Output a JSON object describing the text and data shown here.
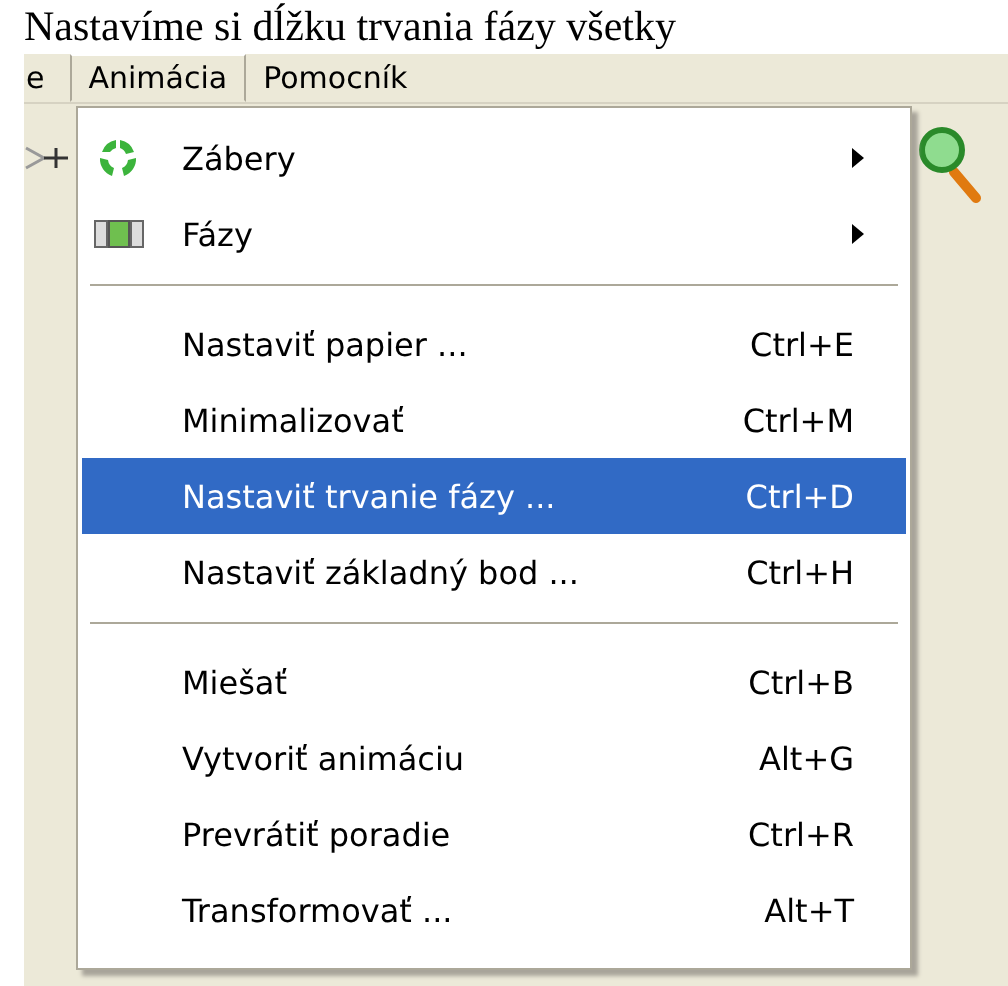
{
  "heading": "Nastavíme si dĺžku trvania fázy všetky",
  "menubar": [
    {
      "label": "e",
      "selected": false
    },
    {
      "label": "Animácia",
      "selected": true
    },
    {
      "label": "Pomocník",
      "selected": false
    }
  ],
  "menu": {
    "sections": [
      [
        {
          "kind": "submenu",
          "label": "Zábery",
          "selected": false
        },
        {
          "kind": "submenu",
          "label": "Fázy",
          "selected": false
        }
      ],
      [
        {
          "kind": "command",
          "label": "Nastaviť papier ...",
          "shortcut": "Ctrl+E",
          "selected": false
        },
        {
          "kind": "command",
          "label": "Minimalizovať",
          "shortcut": "Ctrl+M",
          "selected": false
        },
        {
          "kind": "command",
          "label": "Nastaviť trvanie fázy ...",
          "shortcut": "Ctrl+D",
          "selected": true
        },
        {
          "kind": "command",
          "label": "Nastaviť základný bod ...",
          "shortcut": "Ctrl+H",
          "selected": false
        }
      ],
      [
        {
          "kind": "command",
          "label": "Miešať",
          "shortcut": "Ctrl+B",
          "selected": false
        },
        {
          "kind": "command",
          "label": "Vytvoriť animáciu",
          "shortcut": "Alt+G",
          "selected": false
        },
        {
          "kind": "command",
          "label": "Prevrátiť poradie",
          "shortcut": "Ctrl+R",
          "selected": false
        },
        {
          "kind": "command",
          "label": "Transformovať ...",
          "shortcut": "Alt+T",
          "selected": false
        }
      ]
    ]
  }
}
